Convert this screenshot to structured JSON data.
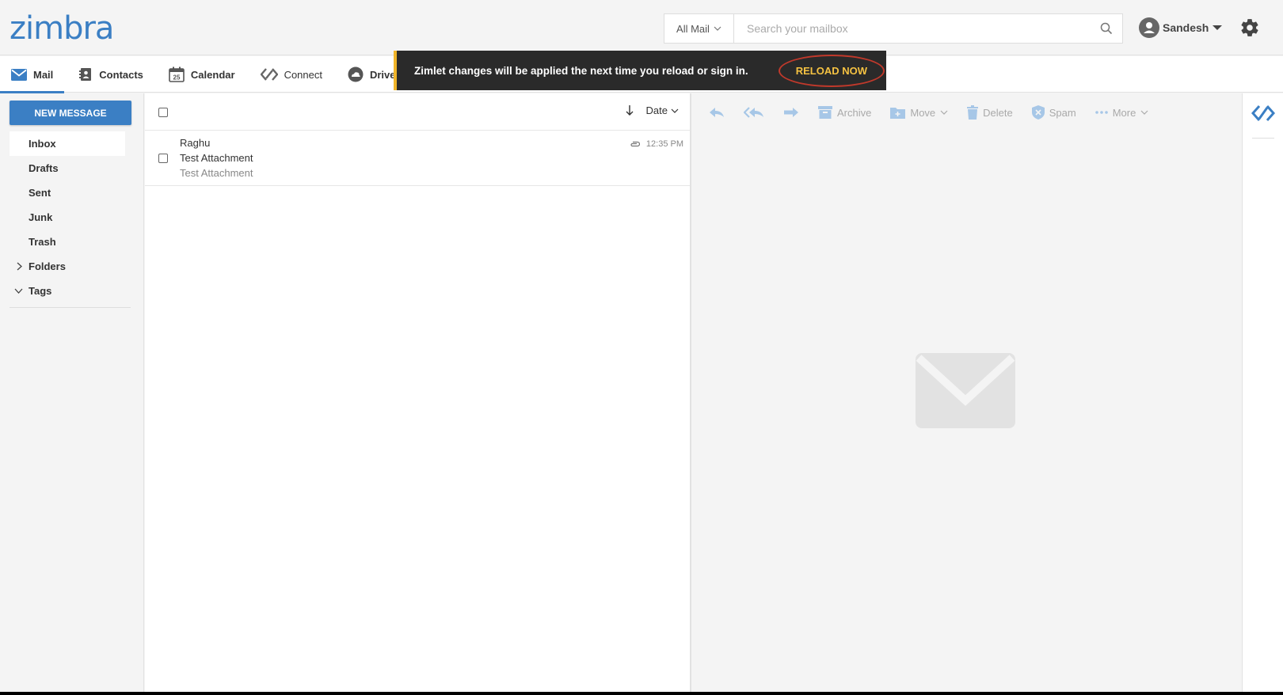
{
  "header": {
    "logo": "zimbra",
    "search_scope": "All Mail",
    "search_placeholder": "Search your mailbox",
    "user_name": "Sandesh"
  },
  "tabs": [
    {
      "label": "Mail",
      "icon": "mail-icon",
      "active": true
    },
    {
      "label": "Contacts",
      "icon": "contacts-icon"
    },
    {
      "label": "Calendar",
      "icon": "calendar-icon",
      "calendar_day": "25"
    },
    {
      "label": "Connect",
      "icon": "connect-icon"
    },
    {
      "label": "Drive",
      "icon": "drive-icon"
    }
  ],
  "toast": {
    "message": "Zimlet changes will be applied the next time you reload or sign in.",
    "action": "RELOAD NOW"
  },
  "sidebar": {
    "new_message": "NEW MESSAGE",
    "folders": [
      {
        "label": "Inbox",
        "active": true
      },
      {
        "label": "Drafts"
      },
      {
        "label": "Sent"
      },
      {
        "label": "Junk"
      },
      {
        "label": "Trash"
      },
      {
        "label": "Folders",
        "toggle": "collapsed"
      },
      {
        "label": "Tags",
        "toggle": "expanded"
      }
    ]
  },
  "list": {
    "sort_label": "Date",
    "messages": [
      {
        "sender": "Raghu",
        "subject": "Test Attachment",
        "preview": "Test Attachment",
        "time": "12:35 PM"
      }
    ]
  },
  "toolbar": {
    "archive": "Archive",
    "move": "Move",
    "delete": "Delete",
    "spam": "Spam",
    "more": "More"
  },
  "colors": {
    "accent": "#3b7fc4",
    "toast_bg": "#2a2a2a",
    "toast_action": "#f5c242",
    "highlight_ring": "#c0392b"
  }
}
